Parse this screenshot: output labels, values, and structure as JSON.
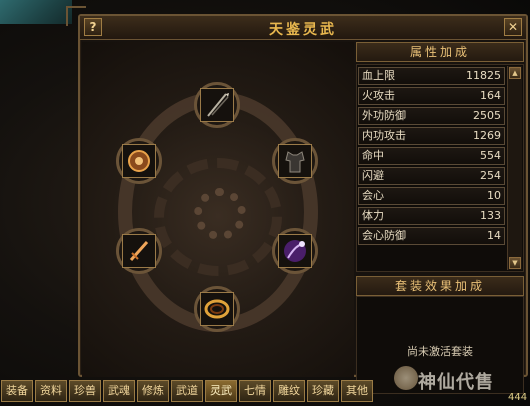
{
  "window": {
    "title": "天鉴灵武",
    "help_label": "?",
    "close_label": "✕"
  },
  "slots": [
    {
      "name": "spear",
      "icon": "spear-icon"
    },
    {
      "name": "amulet",
      "icon": "amulet-icon"
    },
    {
      "name": "armor",
      "icon": "armor-icon"
    },
    {
      "name": "dagger",
      "icon": "dagger-icon"
    },
    {
      "name": "chain-weapon",
      "icon": "chain-weapon-icon"
    },
    {
      "name": "bracelet",
      "icon": "bracelet-icon"
    }
  ],
  "attributes": {
    "header": "属性加成",
    "rows": [
      {
        "label": "血上限",
        "value": "11825"
      },
      {
        "label": "火攻击",
        "value": "164"
      },
      {
        "label": "外功防御",
        "value": "2505"
      },
      {
        "label": "内功攻击",
        "value": "1269"
      },
      {
        "label": "命中",
        "value": "554"
      },
      {
        "label": "闪避",
        "value": "254"
      },
      {
        "label": "会心",
        "value": "10"
      },
      {
        "label": "体力",
        "value": "133"
      },
      {
        "label": "会心防御",
        "value": "14"
      }
    ]
  },
  "set_bonus": {
    "header": "套装效果加成",
    "text": "尚未激活套装"
  },
  "tabs": [
    "装备",
    "资料",
    "珍兽",
    "武魂",
    "修炼",
    "武道",
    "灵武",
    "七情",
    "雕纹",
    "珍藏",
    "其他"
  ],
  "active_tab": "灵武",
  "watermark": "神仙代售",
  "level": "444",
  "colors": {
    "title": "#e9b84f",
    "border": "#6b5434",
    "text": "#e8dcc2"
  }
}
